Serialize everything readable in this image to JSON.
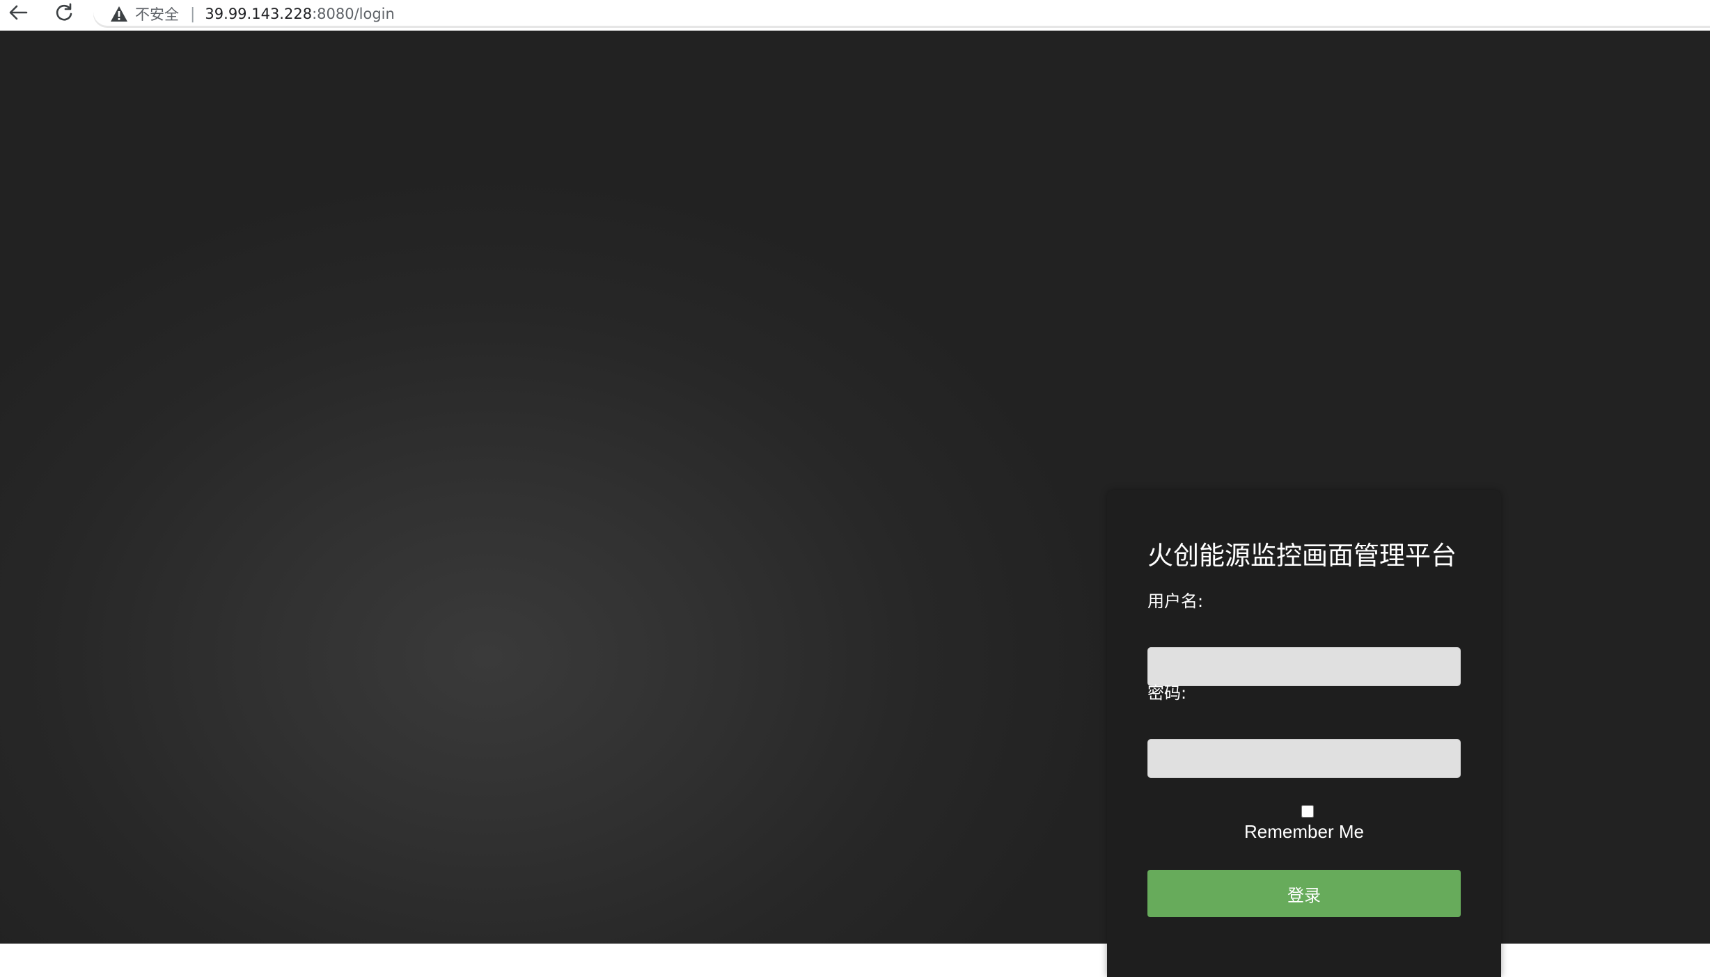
{
  "browser": {
    "back_icon": "arrow-left-icon",
    "reload_icon": "reload-icon",
    "security_icon": "warning-icon",
    "security_text": "不安全",
    "separator": "|",
    "url_host": "39.99.143.228",
    "url_rest": ":8080/login"
  },
  "login": {
    "title": "火创能源监控画面管理平台",
    "username_label": "用户名:",
    "username_value": "",
    "password_label": "密码:",
    "password_value": "",
    "remember_label": "Remember Me",
    "remember_checked": false,
    "submit_label": "登录"
  },
  "colors": {
    "background": "#2b2b2b",
    "card": "#1e1e1e",
    "input": "#e0e0e0",
    "button": "#67ab5b",
    "text": "#ffffff"
  }
}
